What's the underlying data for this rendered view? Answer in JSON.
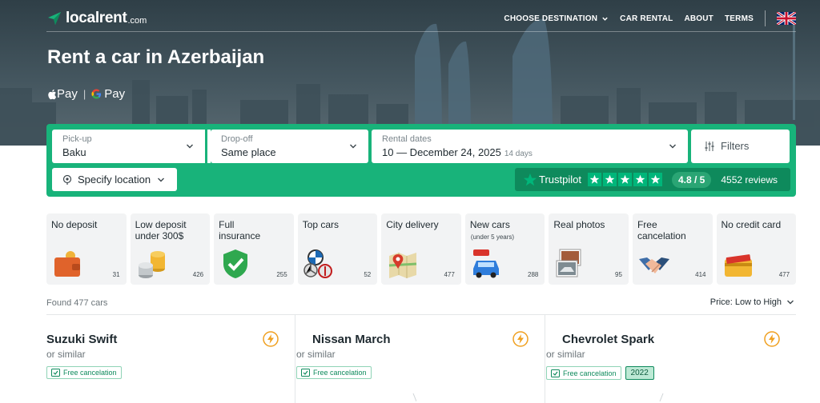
{
  "header": {
    "logo_text": "localrent",
    "logo_suffix": ".com",
    "nav": [
      {
        "label": "CHOOSE DESTINATION",
        "has_dropdown": true
      },
      {
        "label": "CAR RENTAL"
      },
      {
        "label": "ABOUT"
      },
      {
        "label": "TERMS"
      }
    ],
    "language_icon": "uk-flag-icon"
  },
  "hero": {
    "title": "Rent a car in Azerbaijan",
    "apple_pay": "Pay",
    "google_pay": "Pay",
    "pay_separator": "|"
  },
  "search": {
    "pickup": {
      "label": "Pick-up",
      "value": "Baku"
    },
    "dropoff": {
      "label": "Drop-off",
      "value": "Same place"
    },
    "dates": {
      "label": "Rental dates",
      "value": "10 — December 24, 2025",
      "duration": "14 days"
    },
    "filters_label": "Filters",
    "specify_location": "Specify location"
  },
  "trustpilot": {
    "name": "Trustpilot",
    "stars": 5,
    "score": "4.8 / 5",
    "reviews": "4552 reviews"
  },
  "categories": [
    {
      "title": "No deposit",
      "subtitle": "",
      "count": "31",
      "icon": "wallet-icon"
    },
    {
      "title": "Low deposit under 300$",
      "subtitle": "",
      "count": "426",
      "icon": "coins-icon"
    },
    {
      "title": "Full insurance",
      "subtitle": "",
      "count": "255",
      "icon": "shield-icon"
    },
    {
      "title": "Top cars",
      "subtitle": "",
      "count": "52",
      "icon": "car-brands-icon"
    },
    {
      "title": "City delivery",
      "subtitle": "",
      "count": "477",
      "icon": "map-pin-icon"
    },
    {
      "title": "New cars",
      "subtitle": "(under 5 years)",
      "count": "288",
      "icon": "new-car-icon"
    },
    {
      "title": "Real photos",
      "subtitle": "",
      "count": "95",
      "icon": "photos-icon"
    },
    {
      "title": "Free cancelation",
      "subtitle": "",
      "count": "414",
      "icon": "handshake-icon"
    },
    {
      "title": "No credit card",
      "subtitle": "",
      "count": "477",
      "icon": "credit-card-icon"
    }
  ],
  "results": {
    "found": "Found 477 cars",
    "sort": "Price: Low to High"
  },
  "cars": [
    {
      "name": "Suzuki Swift",
      "similar": "or similar",
      "badge": "Free cancelation",
      "year": ""
    },
    {
      "name": "Nissan March",
      "similar": "or similar",
      "badge": "Free cancelation",
      "year": ""
    },
    {
      "name": "Chevrolet Spark",
      "similar": "or similar",
      "badge": "Free cancelation",
      "year": "2022"
    }
  ],
  "colors": {
    "brand_green": "#18b37a",
    "trustpilot_green": "#00b67a",
    "hero_dark": "#2f3f47",
    "bolt_orange": "#f0a020"
  }
}
